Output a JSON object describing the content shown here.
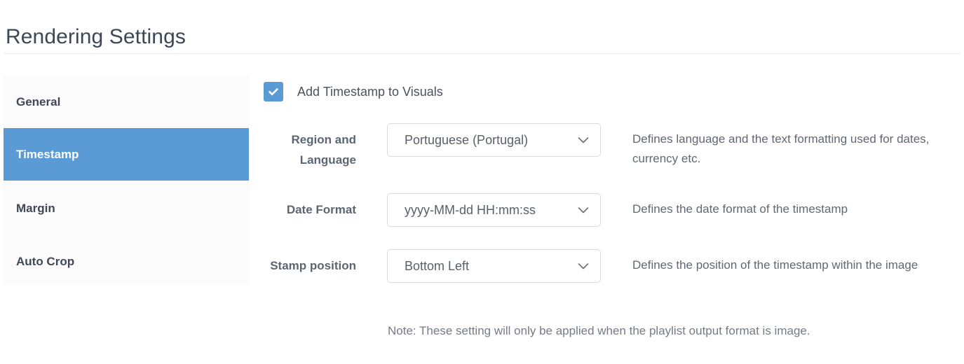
{
  "header": {
    "title": "Rendering Settings"
  },
  "sidebar": {
    "items": [
      {
        "label": "General",
        "active": false
      },
      {
        "label": "Timestamp",
        "active": true
      },
      {
        "label": "Margin",
        "active": false
      },
      {
        "label": "Auto Crop",
        "active": false
      }
    ]
  },
  "main": {
    "timestamp_checkbox": {
      "label": "Add Timestamp to Visuals",
      "checked": true
    },
    "fields": [
      {
        "label": "Region and Language",
        "value": "Portuguese (Portugal)",
        "description": "Defines language and the text formatting used for dates, currency etc."
      },
      {
        "label": "Date Format",
        "value": "yyyy-MM-dd HH:mm:ss",
        "description": "Defines the date format of the timestamp"
      },
      {
        "label": "Stamp position",
        "value": "Bottom Left",
        "description": "Defines the position of the timestamp within the image"
      }
    ],
    "note": "Note: These setting will only be applied when the playlist output format is image."
  },
  "colors": {
    "accent": "#5b9bd5",
    "title": "#3c4858",
    "label": "#5c6673",
    "sidebar_bg": "#fbfbfb",
    "border": "#dcdcdc"
  }
}
